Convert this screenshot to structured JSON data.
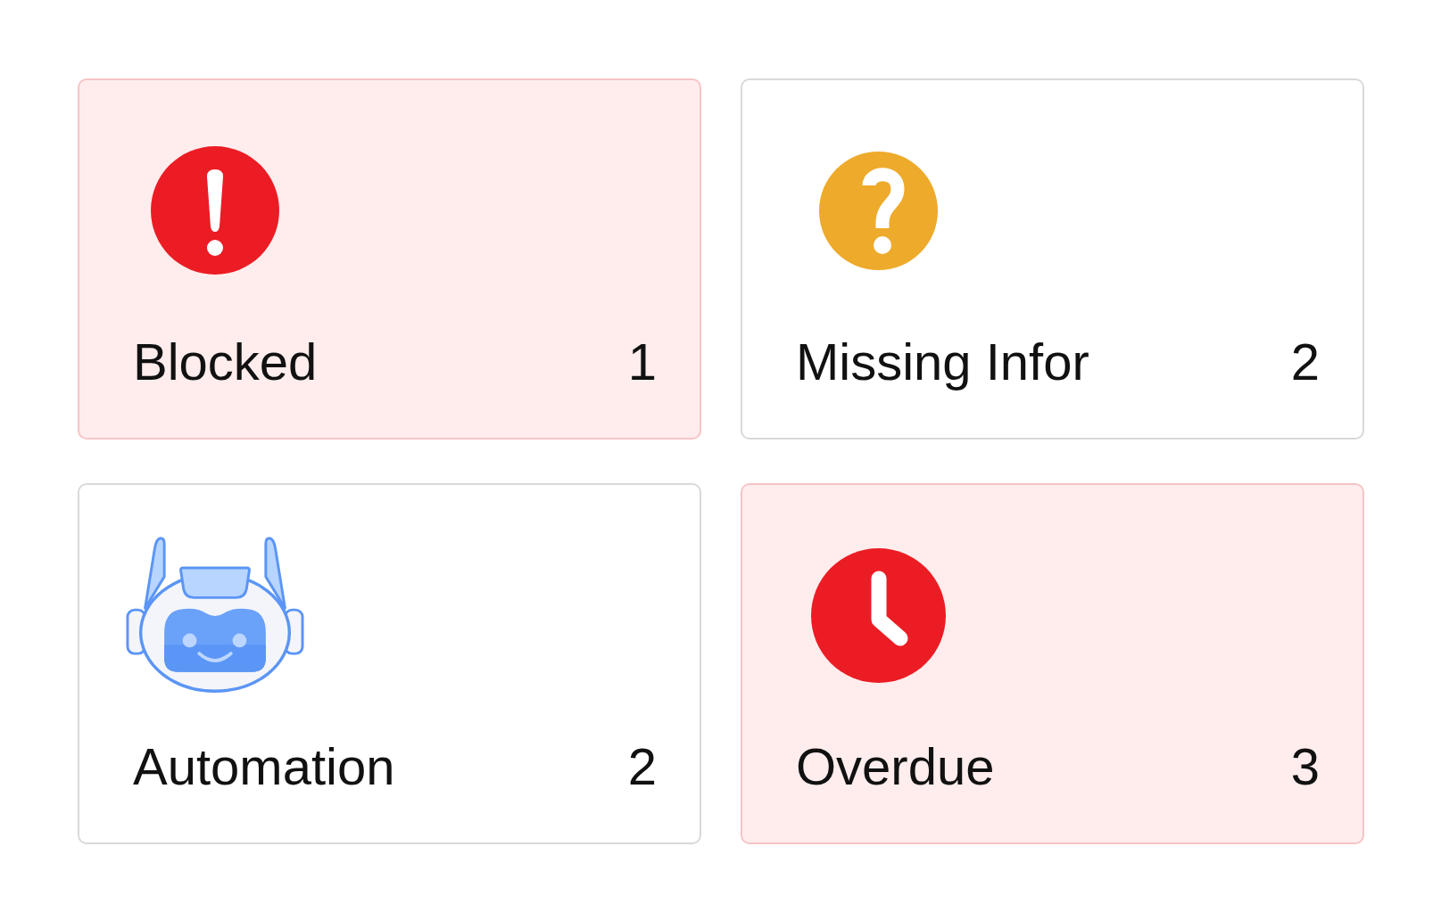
{
  "cards": [
    {
      "kind": "error",
      "label": "Blocked",
      "count": "1",
      "highlighted": true
    },
    {
      "kind": "question",
      "label": "Missing Infor",
      "count": "2",
      "highlighted": false
    },
    {
      "kind": "robot",
      "label": "Automation",
      "count": "2",
      "highlighted": false
    },
    {
      "kind": "clock",
      "label": "Overdue",
      "count": "3",
      "highlighted": true
    }
  ]
}
